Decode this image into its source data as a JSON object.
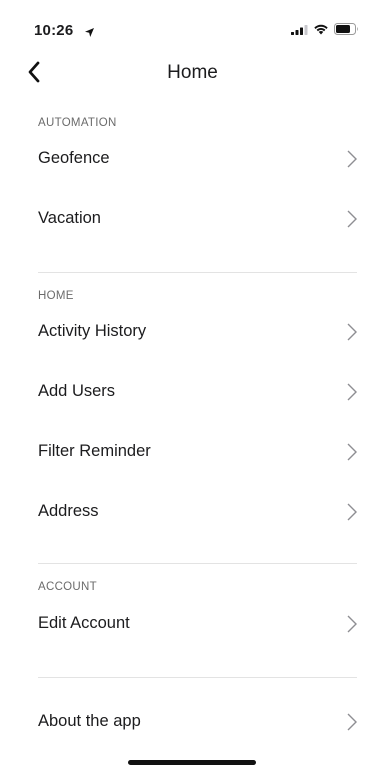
{
  "status_bar": {
    "time": "10:26",
    "location_icon": "location-arrow-icon",
    "signal_icon": "cellular-signal-icon",
    "wifi_icon": "wifi-icon",
    "battery_icon": "battery-icon"
  },
  "nav": {
    "title": "Home",
    "back_icon": "chevron-left-icon"
  },
  "sections": {
    "automation": {
      "header": "AUTOMATION",
      "items": [
        "Geofence",
        "Vacation"
      ]
    },
    "home": {
      "header": "HOME",
      "items": [
        "Activity History",
        "Add Users",
        "Filter Reminder",
        "Address"
      ]
    },
    "account": {
      "header": "ACCOUNT",
      "items": [
        "Edit Account"
      ]
    },
    "about": {
      "items": [
        "About the app"
      ]
    }
  },
  "colors": {
    "text": "#1c1c1e",
    "section_header": "#6b6b6b",
    "divider": "#e3e3e3",
    "chevron": "#8e8e93"
  }
}
